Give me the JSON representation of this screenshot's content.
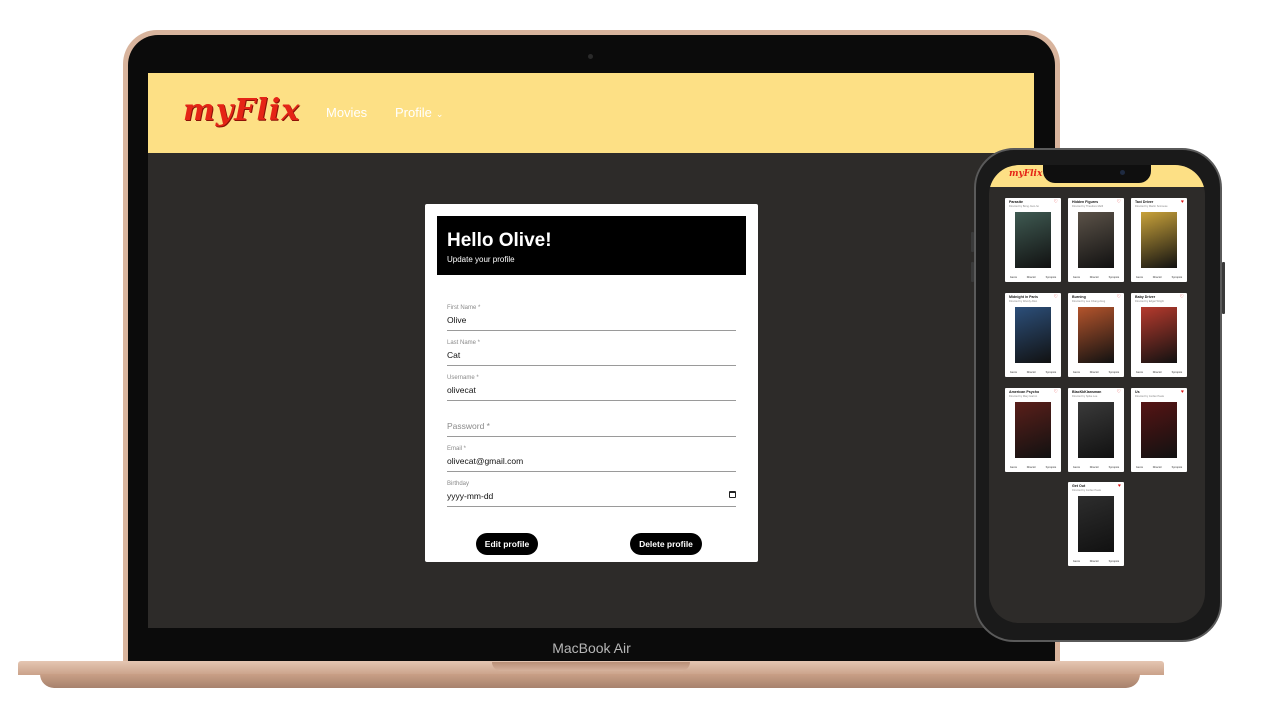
{
  "laptop": {
    "label": "MacBook Air",
    "nav": {
      "logo": "myFlix",
      "movies": "Movies",
      "profile": "Profile",
      "profile_chevron": "⌄"
    },
    "form": {
      "title": "Hello Olive!",
      "subtitle": "Update your profile",
      "fields": [
        {
          "label": "First Name *",
          "value": "Olive"
        },
        {
          "label": "Last Name *",
          "value": "Cat"
        },
        {
          "label": "Username *",
          "value": "olivecat"
        },
        {
          "label": "",
          "placeholder": "Password *"
        },
        {
          "label": "Email *",
          "value": "olivecat@gmail.com"
        },
        {
          "label": "Birthday",
          "value": "yyyy-mm-dd"
        }
      ],
      "edit_button": "Edit profile",
      "delete_button": "Delete profile"
    }
  },
  "phone": {
    "logo": "myFlix",
    "movies": [
      {
        "title": "Parasite",
        "director": "Directed by Bong Joon-ho",
        "heart": "♡",
        "poster_color": "#3f5a52"
      },
      {
        "title": "Hidden Figures",
        "director": "Directed by Theodore Melfi",
        "heart": "♡",
        "poster_color": "#5b5248"
      },
      {
        "title": "Taxi Driver",
        "director": "Directed by Martin Scorsese",
        "heart": "♥",
        "poster_color": "#c9a23a"
      },
      {
        "title": "Midnight in Paris",
        "director": "Directed by Woody Allen",
        "heart": "♡",
        "poster_color": "#2c4f7a"
      },
      {
        "title": "Burning",
        "director": "Directed by Lee Chang-dong",
        "heart": "♡",
        "poster_color": "#b4542c"
      },
      {
        "title": "Baby Driver",
        "director": "Directed by Edgar Wright",
        "heart": "♡",
        "poster_color": "#b63a2d"
      },
      {
        "title": "American Psycho",
        "director": "Directed by Mary Harron",
        "heart": "♡",
        "poster_color": "#5a1f1a"
      },
      {
        "title": "BlacKkKlansman",
        "director": "Directed by Spike Lee",
        "heart": "♡",
        "poster_color": "#3a3a3a"
      },
      {
        "title": "Us",
        "director": "Directed by Jordan Peele",
        "heart": "♥",
        "poster_color": "#561414"
      },
      {
        "title": "Get Out",
        "director": "Directed by Jordan Peele",
        "heart": "♥",
        "poster_color": "#2d2d2d"
      }
    ],
    "actions": [
      "Genre",
      "Director",
      "Synopsis"
    ]
  }
}
